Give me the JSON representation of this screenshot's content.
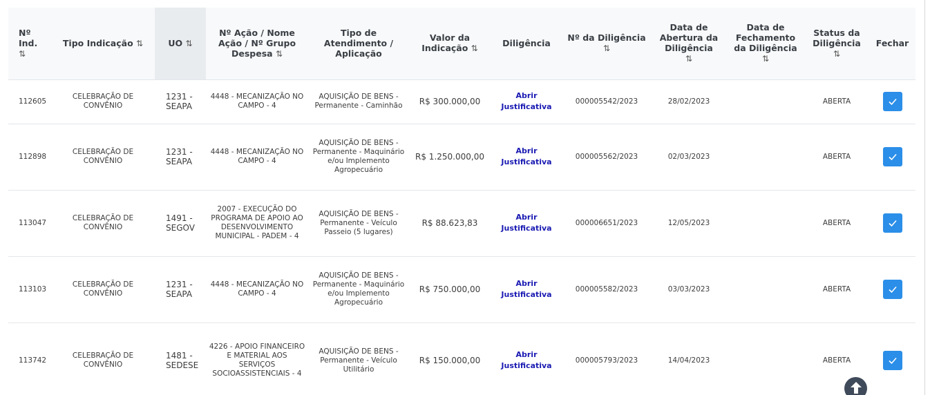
{
  "table": {
    "headers": {
      "num_ind": "Nº Ind.",
      "tipo_indicacao": "Tipo Indicação",
      "uo": "UO",
      "acao": "Nº Ação / Nome Ação / Nº Grupo Despesa",
      "tipo_atendimento": "Tipo de Atendimento / Aplicação",
      "valor": "Valor da Indicação",
      "diligencia": "Diligência",
      "num_diligencia": "Nº da Diligência",
      "data_abertura": "Data de Abertura da Diligência",
      "data_fechamento": "Data de Fechamento da Diligência",
      "status": "Status da Diligência",
      "fechar": "Fechar"
    },
    "sort_icon": "⇅",
    "rows": [
      {
        "num_ind": "112605",
        "tipo": "CELEBRAÇÃO DE CONVÊNIO",
        "uo": "1231 - SEAPA",
        "acao": "4448 - MECANIZAÇÃO NO CAMPO - 4",
        "tipo_atendimento": "AQUISIÇÃO DE BENS - Permanente - Caminhão",
        "valor": "R$ 300.000,00",
        "diligencia": "Abrir Justificativa",
        "num_diligencia": "000005542/2023",
        "data_abertura": "28/02/2023",
        "data_fechamento": "",
        "status": "ABERTA"
      },
      {
        "num_ind": "112898",
        "tipo": "CELEBRAÇÃO DE CONVÊNIO",
        "uo": "1231 - SEAPA",
        "acao": "4448 - MECANIZAÇÃO NO CAMPO - 4",
        "tipo_atendimento": "AQUISIÇÃO DE BENS - Permanente - Maquinário e/ou Implemento Agropecuário",
        "valor": "R$ 1.250.000,00",
        "diligencia": "Abrir Justificativa",
        "num_diligencia": "000005562/2023",
        "data_abertura": "02/03/2023",
        "data_fechamento": "",
        "status": "ABERTA"
      },
      {
        "num_ind": "113047",
        "tipo": "CELEBRAÇÃO DE CONVÊNIO",
        "uo": "1491 - SEGOV",
        "acao": "2007 - EXECUÇÃO DO PROGRAMA DE APOIO AO DESENVOLVIMENTO MUNICIPAL - PADEM - 4",
        "tipo_atendimento": "AQUISIÇÃO DE BENS - Permanente - Veículo Passeio (5 lugares)",
        "valor": "R$ 88.623,83",
        "diligencia": "Abrir Justificativa",
        "num_diligencia": "000006651/2023",
        "data_abertura": "12/05/2023",
        "data_fechamento": "",
        "status": "ABERTA"
      },
      {
        "num_ind": "113103",
        "tipo": "CELEBRAÇÃO DE CONVÊNIO",
        "uo": "1231 - SEAPA",
        "acao": "4448 - MECANIZAÇÃO NO CAMPO - 4",
        "tipo_atendimento": "AQUISIÇÃO DE BENS - Permanente - Maquinário e/ou Implemento Agropecuário",
        "valor": "R$ 750.000,00",
        "diligencia": "Abrir Justificativa",
        "num_diligencia": "000005582/2023",
        "data_abertura": "03/03/2023",
        "data_fechamento": "",
        "status": "ABERTA"
      },
      {
        "num_ind": "113742",
        "tipo": "CELEBRAÇÃO DE CONVÊNIO",
        "uo": "1481 - SEDESE",
        "acao": "4226 - APOIO FINANCEIRO E MATERIAL AOS SERVIÇOS SOCIOASSISTENCIAIS - 4",
        "tipo_atendimento": "AQUISIÇÃO DE BENS - Permanente - Veículo Utilitário",
        "valor": "R$ 150.000,00",
        "diligencia": "Abrir Justificativa",
        "num_diligencia": "000005793/2023",
        "data_abertura": "14/04/2023",
        "data_fechamento": "",
        "status": "ABERTA"
      }
    ]
  },
  "colors": {
    "accent": "#2b8ee8",
    "link": "#1a1ab3",
    "header_bg": "#f8f9fa",
    "sorted_header_bg": "#e9ecef"
  },
  "icons": {
    "check": "check-icon",
    "scroll_top": "arrow-up-icon"
  }
}
